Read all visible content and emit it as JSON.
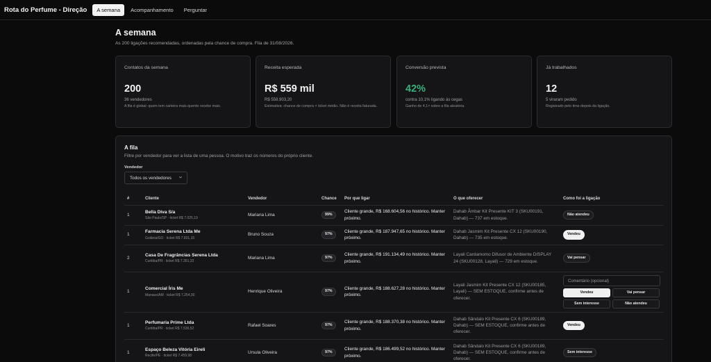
{
  "app": {
    "title": "Rota do Perfume - Direção",
    "tabs": [
      {
        "label": "A semana",
        "active": true
      },
      {
        "label": "Acompanhamento",
        "active": false
      },
      {
        "label": "Perguntar",
        "active": false
      }
    ]
  },
  "header": {
    "title": "A semana",
    "subtitle": "As 200 ligações recomendadas, ordenadas pela chance de compra. Fila de 31/08/2026."
  },
  "cards": [
    {
      "label": "Contatos da semana",
      "value": "200",
      "note": "36 vendedores",
      "desc": "A fila é global: quem tem carteira mais quente recebe mais."
    },
    {
      "label": "Receita esperada",
      "value": "R$ 559 mil",
      "note": "R$ 558.903,20",
      "desc": "Estimativa: chance de compra × ticket médio. Não é receita faturada."
    },
    {
      "label": "Conversão prevista",
      "value": "42%",
      "note": "contra 10,1% ligando às cegas",
      "desc": "Ganho de 4,1× sobre a fila aleatória."
    },
    {
      "label": "Já trabalhados",
      "value": "12",
      "note": "5 viraram pedido",
      "desc": "Registrado pelo time depois da ligação."
    }
  ],
  "queue": {
    "title": "A fila",
    "subtitle": "Filtre por vendedor para ver a lista de uma pessoa. O motivo traz os números do próprio cliente.",
    "filter_label": "Vendedor",
    "filter_value": "Todos os vendedores",
    "columns": [
      "#",
      "Cliente",
      "Vendedor",
      "Chance",
      "Por que ligar",
      "O que oferecer",
      "Como foi a ligação"
    ],
    "comment_placeholder": "Comentário (opcional)",
    "buttons": {
      "sold": "Vendeu",
      "will_think": "Vai pensar",
      "no_interest": "Sem interesse",
      "no_answer": "Não atendeu"
    },
    "rows": [
      {
        "rank": "1",
        "client": "Bella Diva S/a",
        "meta": "São Paulo/SP · ticket R$ 7.025,19",
        "seller": "Mariana Lima",
        "chance": "99%",
        "reason": "Cliente grande, R$ 168.604,56 no histórico. Manter próximo.",
        "offer": "Dahab Âmbar Kit Presente KIT 3 (SKU00191, Dahab) — 737 em estoque.",
        "status": "Não atendeu",
        "status_light": false
      },
      {
        "rank": "1",
        "client": "Farmacia Serena Ltda Me",
        "meta": "Goiânia/GO · ticket R$ 7.831,15",
        "seller": "Bruno Souza",
        "chance": "97%",
        "reason": "Cliente grande, R$ 187.947,65 no histórico. Manter próximo.",
        "offer": "Dahab Jasmim Kit Presente CX 12 (SKU00190, Dahab) — 735 em estoque.",
        "status": "Vendeu",
        "status_light": true
      },
      {
        "rank": "2",
        "client": "Casa De Fragrâncias Serena Ltda",
        "meta": "Curitiba/PR · ticket R$ 7.351,33",
        "seller": "Mariana Lima",
        "chance": "97%",
        "reason": "Cliente grande, R$ 191.134,49 no histórico. Manter próximo.",
        "offer": "Layali Cardamomo Difusor de Ambiente DISPLAY 24 (SKU00128, Layali) — 729 em estoque.",
        "status": "Vai pensar",
        "status_light": false
      },
      {
        "rank": "1",
        "client": "Comercial Íris Me",
        "meta": "Manaus/AM · ticket R$ 7.254,00",
        "seller": "Henrique Oliveira",
        "chance": "97%",
        "reason": "Cliente grande, R$ 188.627,28 no histórico. Manter próximo.",
        "offer": "Layali Jasmim Kit Presente CX 12 (SKU00185, Layali) — SEM ESTOQUE, confirme antes de oferecer.",
        "status": "",
        "status_light": false
      },
      {
        "rank": "1",
        "client": "Perfumaria Prime Ltda",
        "meta": "Curitiba/PR · ticket R$ 7.536,52",
        "seller": "Rafael Soares",
        "chance": "97%",
        "reason": "Cliente grande, R$ 188.370,38 no histórico. Manter próximo.",
        "offer": "Dahab Sândalo Kit Presente CX 6 (SKU00189, Dahab) — SEM ESTOQUE, confirme antes de oferecer.",
        "status": "Vendeu",
        "status_light": true
      },
      {
        "rank": "1",
        "client": "Espaço Beleza Vitória Eireli",
        "meta": "Recife/PE · ticket R$ 7.459,98",
        "seller": "Ursula Oliveira",
        "chance": "97%",
        "reason": "Cliente grande, R$ 186.499,52 no histórico. Manter próximo.",
        "offer": "Dahab Sândalo Kit Presente CX 6 (SKU00189, Dahab) — SEM ESTOQUE, confirme antes de oferecer.",
        "status": "Sem interesse",
        "status_light": false
      }
    ]
  }
}
